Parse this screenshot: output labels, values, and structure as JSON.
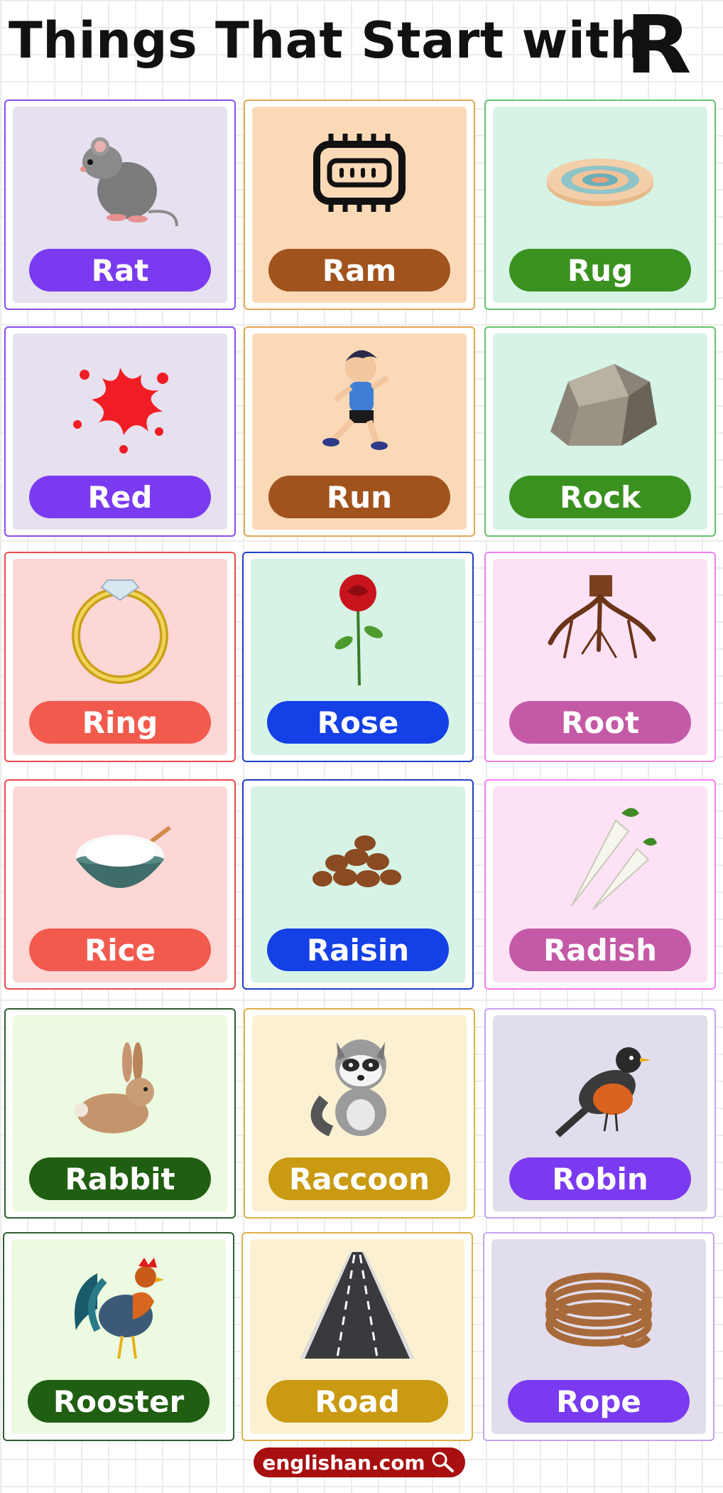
{
  "header": {
    "title": "Things That Start with",
    "letter": "R"
  },
  "cards": [
    {
      "word": "Rat",
      "icon": "rat-icon",
      "theme": "purple"
    },
    {
      "word": "Ram",
      "icon": "ram-chip-icon",
      "theme": "brown"
    },
    {
      "word": "Rug",
      "icon": "rug-icon",
      "theme": "green"
    },
    {
      "word": "Red",
      "icon": "red-splash-icon",
      "theme": "purple"
    },
    {
      "word": "Run",
      "icon": "running-boy-icon",
      "theme": "brown"
    },
    {
      "word": "Rock",
      "icon": "rock-icon",
      "theme": "green"
    },
    {
      "word": "Ring",
      "icon": "ring-icon",
      "theme": "coral"
    },
    {
      "word": "Rose",
      "icon": "rose-icon",
      "theme": "blue"
    },
    {
      "word": "Root",
      "icon": "root-icon",
      "theme": "pink"
    },
    {
      "word": "Rice",
      "icon": "rice-bowl-icon",
      "theme": "coral"
    },
    {
      "word": "Raisin",
      "icon": "raisin-icon",
      "theme": "blue"
    },
    {
      "word": "Radish",
      "icon": "radish-icon",
      "theme": "pink"
    },
    {
      "word": "Rabbit",
      "icon": "rabbit-icon",
      "theme": "dgreen"
    },
    {
      "word": "Raccoon",
      "icon": "raccoon-icon",
      "theme": "gold"
    },
    {
      "word": "Robin",
      "icon": "robin-icon",
      "theme": "lav"
    },
    {
      "word": "Rooster",
      "icon": "rooster-icon",
      "theme": "dgreen"
    },
    {
      "word": "Road",
      "icon": "road-icon",
      "theme": "gold"
    },
    {
      "word": "Rope",
      "icon": "rope-icon",
      "theme": "lav"
    }
  ],
  "footer": {
    "site": "englishan.com",
    "icon": "magnifier-icon"
  },
  "colors": {
    "purple": "#7a3af0",
    "brown": "#a1531e",
    "green": "#3b9120",
    "coral": "#f25a4e",
    "blue": "#1440e6",
    "pink": "#c45aa6",
    "dark_green": "#205e12",
    "gold": "#c99a12",
    "footer": "#a80f10"
  }
}
